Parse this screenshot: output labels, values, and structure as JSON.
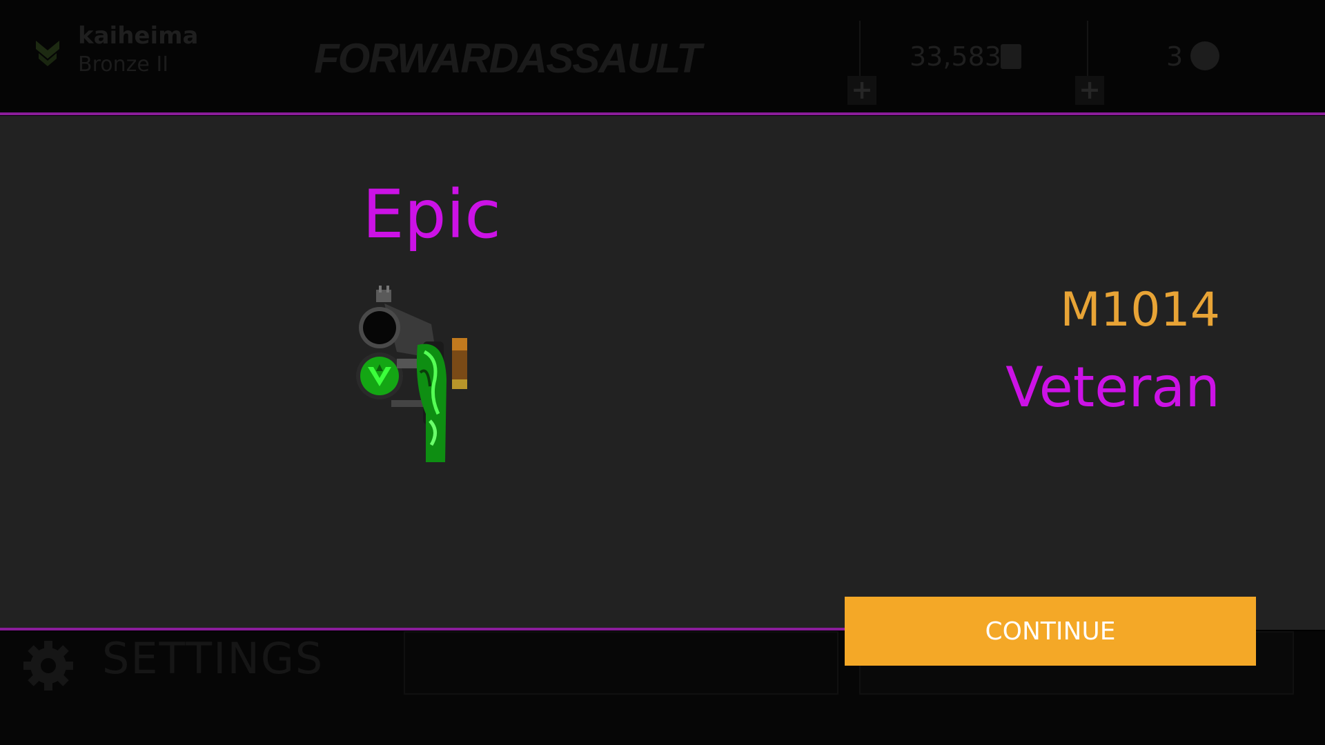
{
  "header": {
    "username": "kaiheima",
    "rank": "Bronze II",
    "logo_text": "FORWARDASSAULT",
    "credits": "33,583",
    "gold": "3",
    "plus_label": "+"
  },
  "footer": {
    "settings_label": "SETTINGS"
  },
  "reward": {
    "rarity_heading": "Epic",
    "weapon_name": "M1014",
    "skin_name": "Veteran",
    "continue_label": "CONTINUE"
  },
  "colors": {
    "rarity_epic": "#cc12e6",
    "weapon_name": "#e8a436",
    "continue_button": "#f4a827",
    "modal_background": "#222222",
    "accent_line": "#8a1d9a"
  },
  "icons": {
    "rank": "rank-chevron-icon",
    "credits": "credits-icon",
    "gold": "gold-coin-icon",
    "settings": "gear-icon",
    "weapon": "weapon-skin-image"
  }
}
